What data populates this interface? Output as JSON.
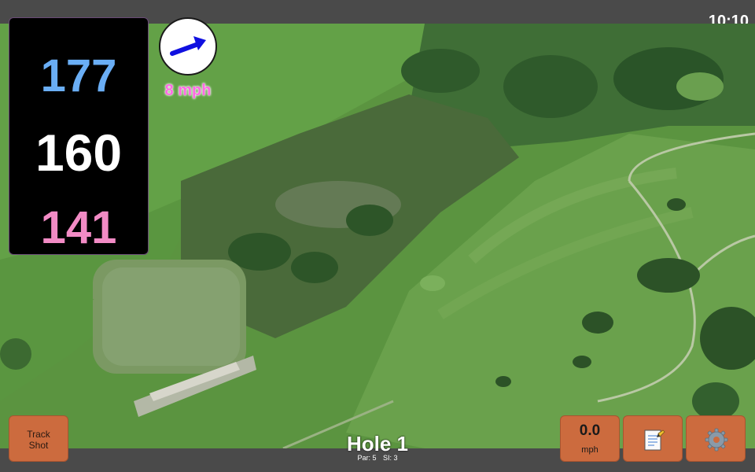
{
  "status_bar": {
    "time": "10:10"
  },
  "distances": {
    "back": "177",
    "middle": "160",
    "front": "141"
  },
  "wind": {
    "speed_text": "8 mph",
    "direction": "northeast"
  },
  "buttons": {
    "track_shot_line1": "Track",
    "track_shot_line2": "Shot",
    "speed_value": "0.0",
    "speed_unit": "mph",
    "notes_icon": "notepad-icon",
    "settings_icon": "gear-icon"
  },
  "hole": {
    "title": "Hole 1",
    "par": "Par: 5",
    "si": "SI: 3"
  },
  "colors": {
    "back": "#6aaef5",
    "middle": "#ffffff",
    "front": "#f28bc5",
    "wind": "#ff6ae4",
    "button": "#cc6b3e"
  }
}
